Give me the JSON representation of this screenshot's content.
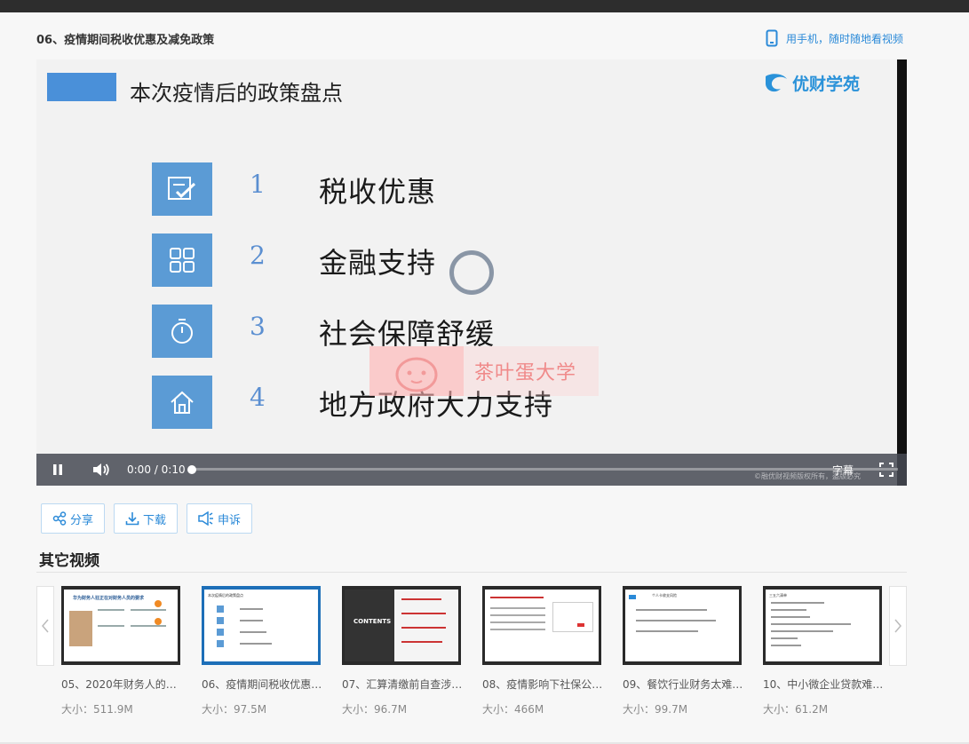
{
  "header": {
    "title": "06、疫情期间税收优惠及减免政策",
    "mobile_link": "用手机，随时随地看视频"
  },
  "slide": {
    "title": "本次疫情后的政策盘点",
    "logo_text": "优财学苑",
    "items": [
      {
        "num": "1",
        "label": "税收优惠",
        "icon": "checklist-icon"
      },
      {
        "num": "2",
        "label": "金融支持",
        "icon": "grid-icon"
      },
      {
        "num": "3",
        "label": "社会保障舒缓",
        "icon": "stopwatch-icon"
      },
      {
        "num": "4",
        "label": "地方政府大力支持",
        "icon": "home-icon"
      }
    ],
    "watermark": "茶叶蛋大学"
  },
  "player": {
    "current_time": "0:00",
    "separator": "/",
    "duration": "0:10",
    "progress": 0,
    "subtitle_label": "字幕",
    "copyright": "©融优财视频版权所有，盗版必究"
  },
  "actions": [
    {
      "label": "分享",
      "icon": "share-icon"
    },
    {
      "label": "下载",
      "icon": "download-icon"
    },
    {
      "label": "申诉",
      "icon": "megaphone-icon"
    }
  ],
  "other_videos": {
    "title": "其它视频",
    "items": [
      {
        "title": "05、2020年财务人的…",
        "size": "大小：511.9M",
        "thumb_heading": "华为财务人狂正在对财务人员的要求"
      },
      {
        "title": "06、疫情期间税收优惠…",
        "size": "大小：97.5M",
        "thumb_heading": "本次疫情后的政策盘点"
      },
      {
        "title": "07、汇算清缴前自查涉…",
        "size": "大小：96.7M",
        "thumb_heading": "CONTENTS"
      },
      {
        "title": "08、疫情影响下社保公…",
        "size": "大小：466M",
        "thumb_heading": ""
      },
      {
        "title": "09、餐饮行业财务太难…",
        "size": "大小：99.7M",
        "thumb_heading": "个人卡收支风险"
      },
      {
        "title": "10、中小微企业贷款难…",
        "size": "大小：61.2M",
        "thumb_heading": "三五六清单"
      }
    ]
  },
  "colors": {
    "accent": "#2b8ad8",
    "slide_blue": "#5b9bd5",
    "active_border": "#1d6fb8"
  }
}
